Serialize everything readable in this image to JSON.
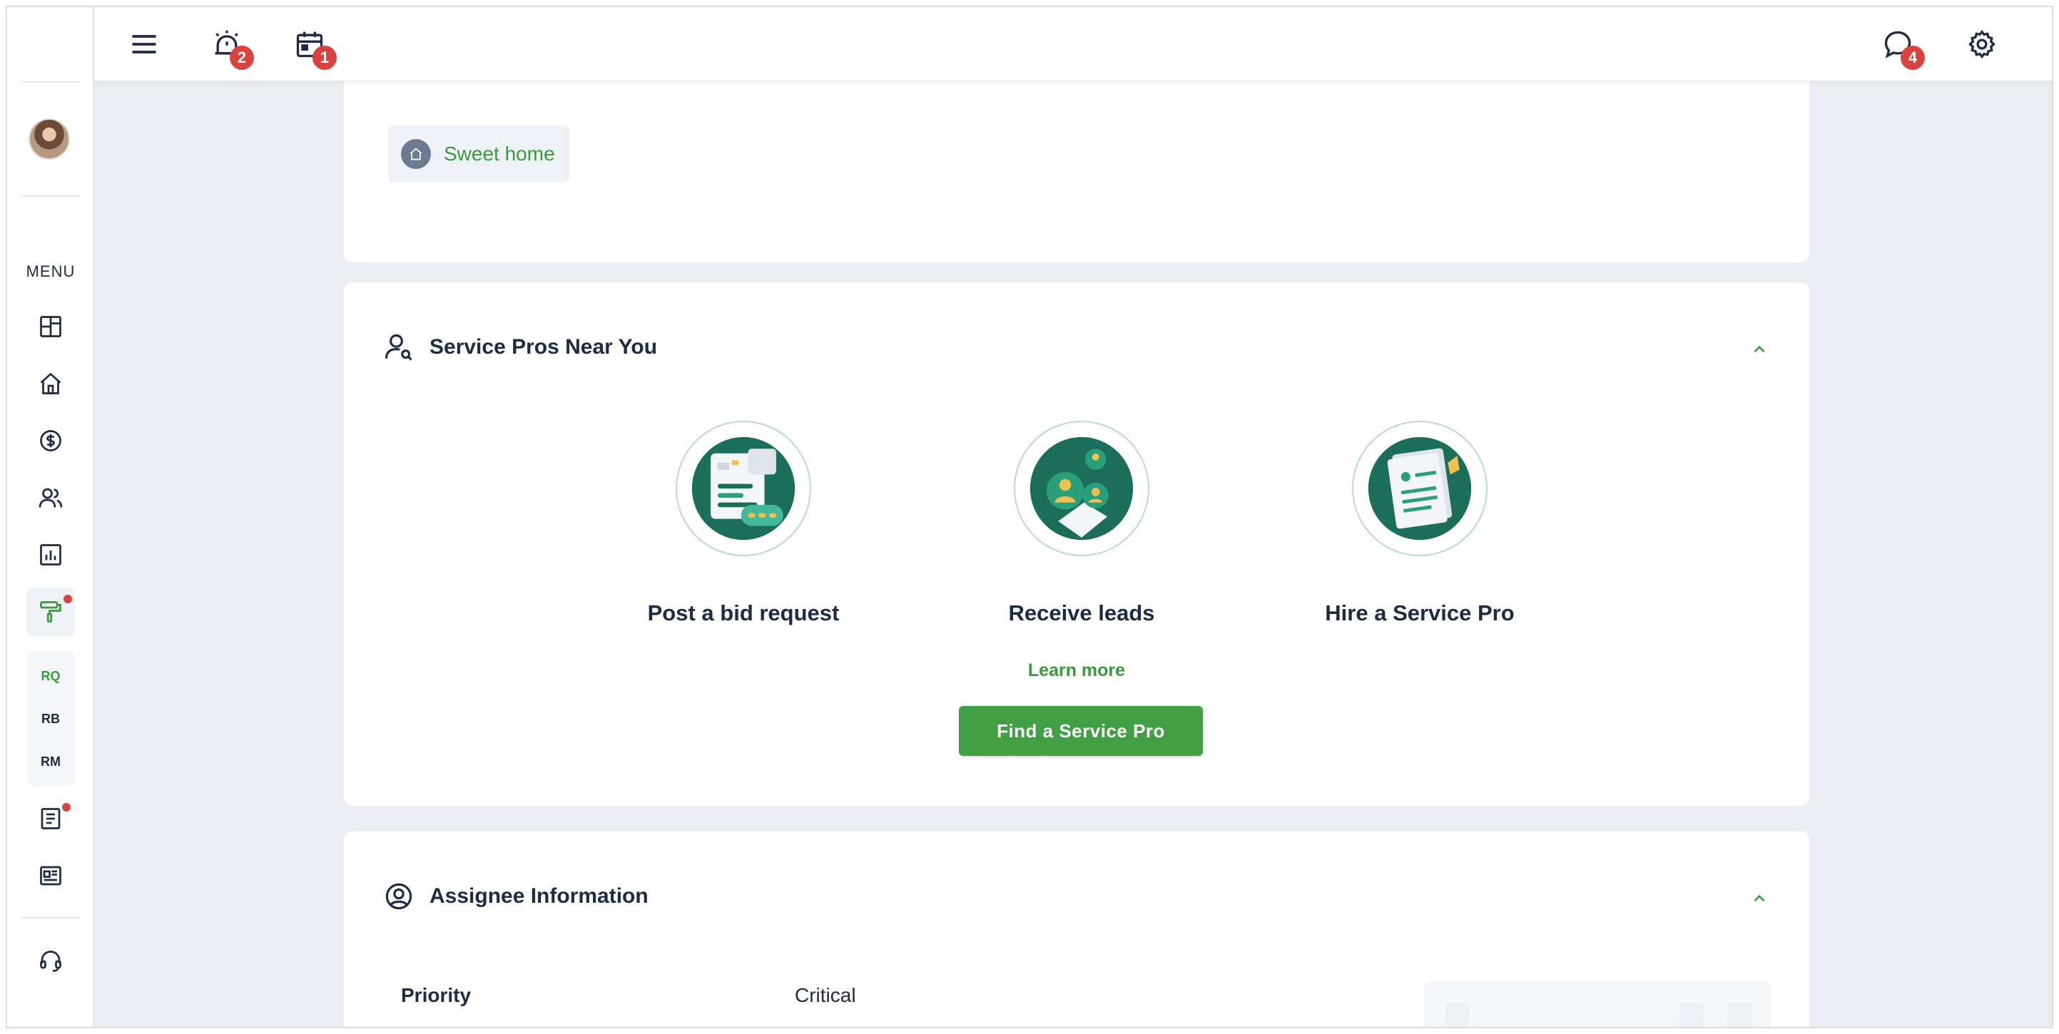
{
  "sidebar": {
    "menu_label": "MENU",
    "icons": [
      "dashboard-icon",
      "home-icon",
      "dollar-icon",
      "users-icon",
      "report-chart-icon",
      "paint-roller-icon",
      "document-icon",
      "news-icon",
      "support-headset-icon"
    ],
    "sub_items": [
      "RQ",
      "RB",
      "RM"
    ]
  },
  "topbar": {
    "alarm_count": "2",
    "calendar_count": "1",
    "messages_count": "4"
  },
  "property": {
    "dash": "—",
    "chip_label": "Sweet home"
  },
  "service_pros": {
    "title": "Service Pros Near You",
    "steps": [
      {
        "label": "Post a bid request"
      },
      {
        "label": "Receive leads"
      },
      {
        "label": "Hire a Service Pro"
      }
    ],
    "learn_more": "Learn more",
    "cta": "Find a Service Pro"
  },
  "assignee": {
    "title": "Assignee Information",
    "priority_label": "Priority",
    "priority_value": "Critical"
  },
  "colors": {
    "accent_green": "#42a044",
    "badge_red": "#d9433f",
    "dark_teal": "#1b6f5a"
  }
}
